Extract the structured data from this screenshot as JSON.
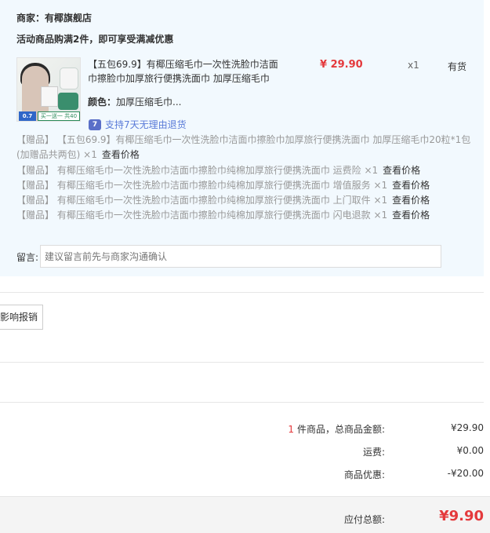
{
  "shop": {
    "label": "商家：",
    "name": "有椰旗舰店",
    "promo": "活动商品购满2件，即可享受满减优惠"
  },
  "product": {
    "thumb_badge": "0.7",
    "thumb_strip": "买一送一 共40粒",
    "title": "【五包69.9】有椰压缩毛巾一次性洗脸巾洁面巾擦脸巾加厚旅行便携洗面巾 加厚压缩毛巾",
    "price": "¥ 29.90",
    "qty": "x1",
    "stock": "有货",
    "color_label": "颜色：",
    "color_value": "加厚压缩毛巾...",
    "return_icon": "7",
    "return_text": "支持7天无理由退货"
  },
  "gifts": {
    "main": "【赠品】 【五包69.9】有椰压缩毛巾一次性洗脸巾洁面巾擦脸巾加厚旅行便携洗面巾 加厚压缩毛巾20粒*1包(加赠品共两包) ×1",
    "main_link": "查看价格",
    "items": [
      {
        "text": "【赠品】 有椰压缩毛巾一次性洗脸巾洁面巾擦脸巾纯棉加厚旅行便携洗面巾 运费险 ×1",
        "link": "查看价格"
      },
      {
        "text": "【赠品】 有椰压缩毛巾一次性洗脸巾洁面巾擦脸巾纯棉加厚旅行便携洗面巾 增值服务 ×1",
        "link": "查看价格"
      },
      {
        "text": "【赠品】 有椰压缩毛巾一次性洗脸巾洁面巾擦脸巾纯棉加厚旅行便携洗面巾 上门取件 ×1",
        "link": "查看价格"
      },
      {
        "text": "【赠品】 有椰压缩毛巾一次性洗脸巾洁面巾擦脸巾纯棉加厚旅行便携洗面巾 闪电退款 ×1",
        "link": "查看价格"
      }
    ]
  },
  "message": {
    "label": "留言:",
    "placeholder": "建议留言前先与商家沟通确认"
  },
  "invoice_button": "影响报销",
  "summary": {
    "count": "1",
    "count_label": "件商品，总商品金额:",
    "subtotal": "¥29.90",
    "shipping_label": "运费:",
    "shipping": "¥0.00",
    "discount_label": "商品优惠:",
    "discount": "-¥20.00",
    "total_label": "应付总额:",
    "total": "¥9.90"
  }
}
